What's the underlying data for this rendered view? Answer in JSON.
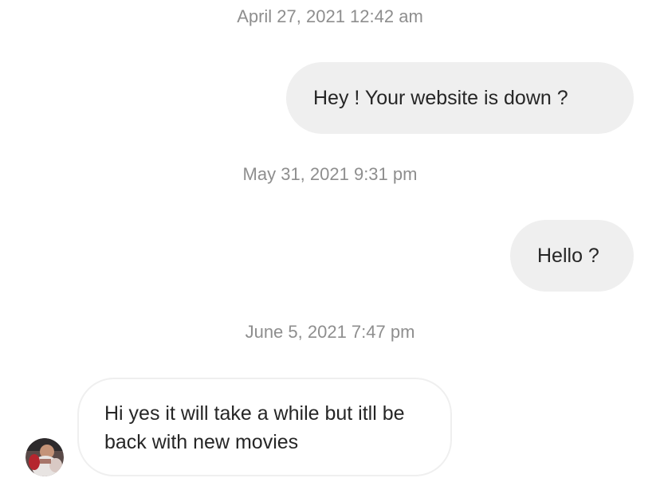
{
  "thread": {
    "messages": [
      {
        "type": "timestamp",
        "text": "April 27, 2021 12:42 am"
      },
      {
        "type": "outgoing",
        "text": "Hey ! Your website is down ?"
      },
      {
        "type": "timestamp",
        "text": "May 31, 2021 9:31 pm"
      },
      {
        "type": "outgoing",
        "text": "Hello ?"
      },
      {
        "type": "timestamp",
        "text": "June 5, 2021 7:47 pm"
      },
      {
        "type": "incoming",
        "text": "Hi yes it will take a while but itll be back with new movies",
        "avatar": "profile-photo"
      }
    ]
  },
  "colors": {
    "timestamp_text": "#8e8e8e",
    "message_text": "#262626",
    "outgoing_bubble": "#efefef",
    "incoming_border": "#efefef",
    "background": "#ffffff"
  }
}
